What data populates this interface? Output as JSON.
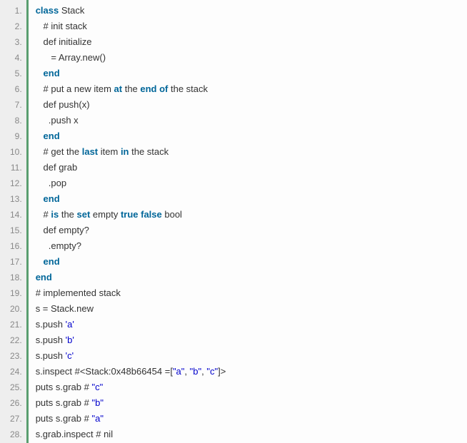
{
  "code": {
    "lines": [
      {
        "n": "1.",
        "tokens": [
          {
            "t": "class",
            "c": "kw"
          },
          {
            "t": " Stack",
            "c": "plain"
          }
        ]
      },
      {
        "n": "2.",
        "tokens": [
          {
            "t": "   # init stack",
            "c": "plain"
          }
        ]
      },
      {
        "n": "3.",
        "tokens": [
          {
            "t": "   def initialize",
            "c": "plain"
          }
        ]
      },
      {
        "n": "4.",
        "tokens": [
          {
            "t": "      = Array.new()",
            "c": "plain"
          }
        ]
      },
      {
        "n": "5.",
        "tokens": [
          {
            "t": "   ",
            "c": "plain"
          },
          {
            "t": "end",
            "c": "kw"
          }
        ]
      },
      {
        "n": "6.",
        "tokens": [
          {
            "t": "   # put a new item ",
            "c": "plain"
          },
          {
            "t": "at",
            "c": "kw"
          },
          {
            "t": " the ",
            "c": "plain"
          },
          {
            "t": "end of",
            "c": "kw"
          },
          {
            "t": " the stack",
            "c": "plain"
          }
        ]
      },
      {
        "n": "7.",
        "tokens": [
          {
            "t": "   def push(x)",
            "c": "plain"
          }
        ]
      },
      {
        "n": "8.",
        "tokens": [
          {
            "t": "     .push x",
            "c": "plain"
          }
        ]
      },
      {
        "n": "9.",
        "tokens": [
          {
            "t": "   ",
            "c": "plain"
          },
          {
            "t": "end",
            "c": "kw"
          }
        ]
      },
      {
        "n": "10.",
        "tokens": [
          {
            "t": "   # get the ",
            "c": "plain"
          },
          {
            "t": "last",
            "c": "kw"
          },
          {
            "t": " item ",
            "c": "plain"
          },
          {
            "t": "in",
            "c": "kw"
          },
          {
            "t": " the stack",
            "c": "plain"
          }
        ]
      },
      {
        "n": "11.",
        "tokens": [
          {
            "t": "   def grab",
            "c": "plain"
          }
        ]
      },
      {
        "n": "12.",
        "tokens": [
          {
            "t": "     .pop",
            "c": "plain"
          }
        ]
      },
      {
        "n": "13.",
        "tokens": [
          {
            "t": "   ",
            "c": "plain"
          },
          {
            "t": "end",
            "c": "kw"
          }
        ]
      },
      {
        "n": "14.",
        "tokens": [
          {
            "t": "   # ",
            "c": "plain"
          },
          {
            "t": "is",
            "c": "kw"
          },
          {
            "t": " the ",
            "c": "plain"
          },
          {
            "t": "set",
            "c": "kw"
          },
          {
            "t": " empty ",
            "c": "plain"
          },
          {
            "t": "true false",
            "c": "kw"
          },
          {
            "t": " bool",
            "c": "plain"
          }
        ]
      },
      {
        "n": "15.",
        "tokens": [
          {
            "t": "   def empty?",
            "c": "plain"
          }
        ]
      },
      {
        "n": "16.",
        "tokens": [
          {
            "t": "     .empty?",
            "c": "plain"
          }
        ]
      },
      {
        "n": "17.",
        "tokens": [
          {
            "t": "   ",
            "c": "plain"
          },
          {
            "t": "end",
            "c": "kw"
          }
        ]
      },
      {
        "n": "18.",
        "tokens": [
          {
            "t": "end",
            "c": "kw"
          }
        ]
      },
      {
        "n": "19.",
        "tokens": [
          {
            "t": "# implemented stack",
            "c": "plain"
          }
        ]
      },
      {
        "n": "20.",
        "tokens": [
          {
            "t": "s = Stack.new",
            "c": "plain"
          }
        ]
      },
      {
        "n": "21.",
        "tokens": [
          {
            "t": "s.push ",
            "c": "plain"
          },
          {
            "t": "'a'",
            "c": "str"
          }
        ]
      },
      {
        "n": "22.",
        "tokens": [
          {
            "t": "s.push ",
            "c": "plain"
          },
          {
            "t": "'b'",
            "c": "str"
          }
        ]
      },
      {
        "n": "23.",
        "tokens": [
          {
            "t": "s.push ",
            "c": "plain"
          },
          {
            "t": "'c'",
            "c": "str"
          }
        ]
      },
      {
        "n": "24.",
        "tokens": [
          {
            "t": "s.inspect #<Stack:0x48b66454 =[",
            "c": "plain"
          },
          {
            "t": "\"a\"",
            "c": "str"
          },
          {
            "t": ", ",
            "c": "plain"
          },
          {
            "t": "\"b\"",
            "c": "str"
          },
          {
            "t": ", ",
            "c": "plain"
          },
          {
            "t": "\"c\"",
            "c": "str"
          },
          {
            "t": "]>",
            "c": "plain"
          }
        ]
      },
      {
        "n": "25.",
        "tokens": [
          {
            "t": "puts s.grab # ",
            "c": "plain"
          },
          {
            "t": "\"c\"",
            "c": "str"
          }
        ]
      },
      {
        "n": "26.",
        "tokens": [
          {
            "t": "puts s.grab # ",
            "c": "plain"
          },
          {
            "t": "\"b\"",
            "c": "str"
          }
        ]
      },
      {
        "n": "27.",
        "tokens": [
          {
            "t": "puts s.grab # ",
            "c": "plain"
          },
          {
            "t": "\"a\"",
            "c": "str"
          }
        ]
      },
      {
        "n": "28.",
        "tokens": [
          {
            "t": "s.grab.inspect # nil",
            "c": "plain"
          }
        ]
      }
    ]
  }
}
